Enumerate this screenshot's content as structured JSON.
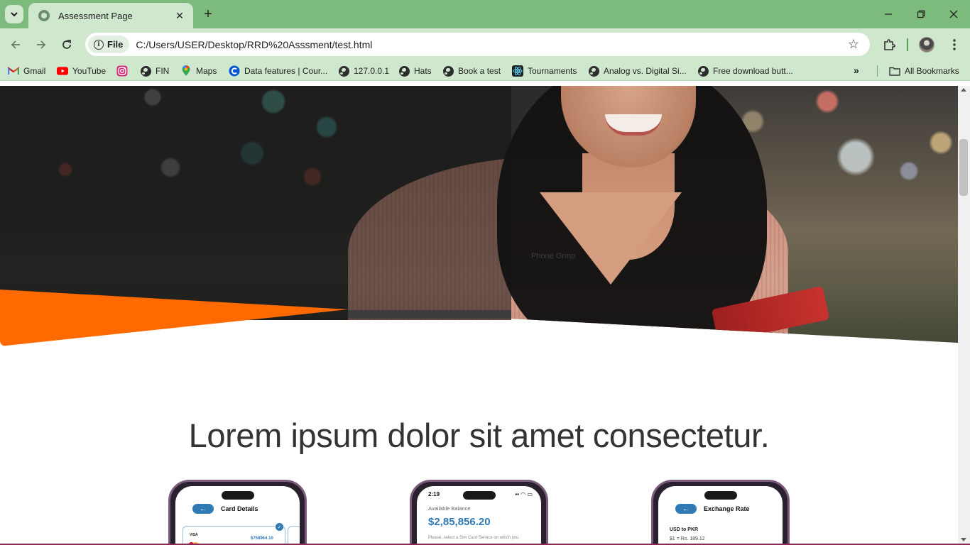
{
  "browser": {
    "tab": {
      "title": "Assessment Page",
      "close_glyph": "✕"
    },
    "new_tab_glyph": "+",
    "window_controls": {
      "minimize": "—",
      "restore": "❐",
      "close": "✕"
    },
    "nav": {
      "back": "←",
      "forward": "→",
      "reload": "↻"
    },
    "omnibox": {
      "chip_label": "File",
      "url": "C:/Users/USER/Desktop/RRD%20Asssment/test.html"
    },
    "bookmarks": [
      {
        "label": "Gmail",
        "icon": "gmail-icon"
      },
      {
        "label": "YouTube",
        "icon": "youtube-icon"
      },
      {
        "label": "",
        "icon": "instagram-icon"
      },
      {
        "label": "FIN",
        "icon": "globe-icon"
      },
      {
        "label": "Maps",
        "icon": "maps-icon"
      },
      {
        "label": "Data features | Cour...",
        "icon": "coursera-icon"
      },
      {
        "label": "127.0.0.1",
        "icon": "globe-icon"
      },
      {
        "label": "Hats",
        "icon": "globe-icon"
      },
      {
        "label": "Book a test",
        "icon": "globe-icon"
      },
      {
        "label": "Tournaments",
        "icon": "react-icon"
      },
      {
        "label": "Analog vs. Digital Si...",
        "icon": "globe-icon"
      },
      {
        "label": "Free download butt...",
        "icon": "globe-icon"
      }
    ],
    "bookmarks_overflow": "»",
    "all_bookmarks": "All Bookmarks"
  },
  "page": {
    "hero": {
      "watermark": "Phone Grmp",
      "accent_color": "#ff6a00"
    },
    "headline": "Lorem ipsum dolor sit amet consectetur.",
    "phones": [
      {
        "screen_title": "Card Details",
        "card_brand": "VISA",
        "card_amount": "$758964.10"
      },
      {
        "time": "2:19",
        "balance_label": "Available Balance",
        "balance_value": "$2,85,856.20",
        "note": "Please, select a Sim Card Service on which you"
      },
      {
        "screen_title": "Exchange Rate",
        "pair": "USD to PKR",
        "rate": "$1 = Rs. 189.12"
      }
    ]
  },
  "colors": {
    "chrome_tabstrip": "#7cbb7c",
    "chrome_toolbar": "#cfe7cd",
    "brand_blue": "#2f79b5"
  }
}
